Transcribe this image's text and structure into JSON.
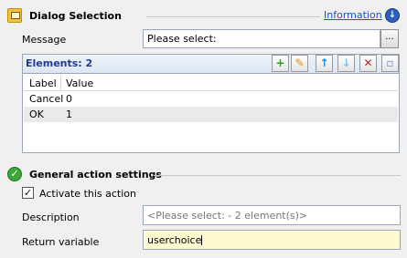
{
  "dialog_section": {
    "title": "Dialog Selection",
    "info_link": "Information",
    "info_icon": "arrow-down-circle-icon"
  },
  "message": {
    "label": "Message",
    "value": "Please select:",
    "browse_label": "..."
  },
  "elements": {
    "title": "Elements: 2",
    "toolbar": [
      "add-icon",
      "edit-icon",
      "move-up-icon",
      "move-down-icon",
      "delete-icon",
      "clear-icon"
    ],
    "columns": [
      "Label",
      "Value"
    ],
    "rows": [
      {
        "label": "Cancel",
        "value": "0"
      },
      {
        "label": "OK",
        "value": "1"
      }
    ],
    "selected_row": 1
  },
  "general": {
    "title": "General action settings",
    "activate_label": "Activate this action",
    "activate_checked": true,
    "description_label": "Description",
    "description_placeholder": "<Please select: - 2 element(s)>",
    "return_label": "Return variable",
    "return_value": "userchoice"
  },
  "colors": {
    "accent_link": "#1a55c0",
    "elements_title": "#1f3a93",
    "return_bg": "#fffbd0"
  }
}
